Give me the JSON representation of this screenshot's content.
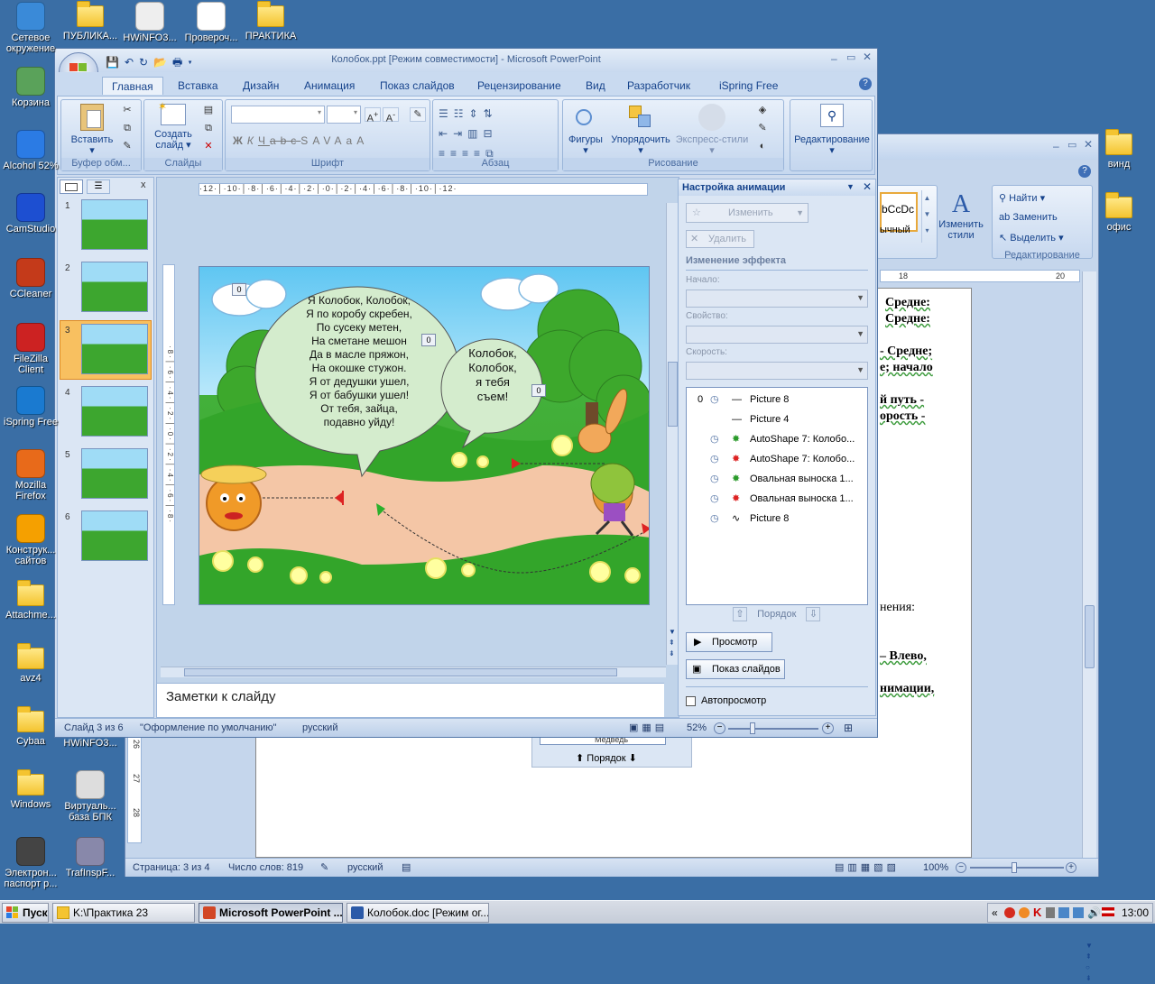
{
  "desktop": {
    "icons_left": [
      {
        "label": "Сетевое окружение",
        "icon": "network-icon"
      },
      {
        "label": "Корзина",
        "icon": "recycle-bin-icon"
      },
      {
        "label": "Alcohol 52%",
        "icon": "alcohol-icon"
      },
      {
        "label": "CamStudio",
        "icon": "camstudio-icon"
      },
      {
        "label": "CCleaner",
        "icon": "ccleaner-icon"
      },
      {
        "label": "FileZilla Client",
        "icon": "filezilla-icon"
      },
      {
        "label": "iSpring Free",
        "icon": "ispring-icon"
      },
      {
        "label": "Mozilla Firefox",
        "icon": "firefox-icon"
      },
      {
        "label": "Конструк... сайтов",
        "icon": "constructor-icon"
      },
      {
        "label": "Attachme...",
        "icon": "folder-icon"
      },
      {
        "label": "avz4",
        "icon": "folder-icon"
      },
      {
        "label": "Cybaa",
        "icon": "folder-icon"
      },
      {
        "label": "Windows",
        "icon": "folder-icon"
      },
      {
        "label": "Электрон... паспорт р...",
        "icon": "passport-icon"
      }
    ],
    "icons_top": [
      {
        "label": "ПУБЛИКА...",
        "icon": "folder-icon"
      },
      {
        "label": "HWiNFO3...",
        "icon": "hwinfo-icon"
      },
      {
        "label": "Провероч...",
        "icon": "word-doc-icon"
      },
      {
        "label": "ПРАКТИКА",
        "icon": "folder-icon"
      }
    ],
    "icons_col2": [
      {
        "label": "HWiNFO3...",
        "icon": "hwinfo-icon"
      },
      {
        "label": "Виртуаль... база БПК",
        "icon": "database-icon"
      },
      {
        "label": "TrafInspF...",
        "icon": "trafinsp-icon"
      }
    ],
    "icons_right": [
      {
        "label": "винд",
        "icon": "folder-icon"
      },
      {
        "label": "офис",
        "icon": "folder-icon"
      }
    ]
  },
  "taskbar": {
    "start": "Пуск",
    "buttons": [
      "K:\\Практика 23",
      "Microsoft PowerPoint ...",
      "Колобок.doc [Режим ог..."
    ],
    "clock": "13:00"
  },
  "word": {
    "find": "Найти",
    "replace": "Заменить",
    "select": "Выделить",
    "change_styles": "Изменить стили",
    "style_preview": "bCcDc",
    "style_name": "ычный",
    "edit_group": "Редактирование",
    "ruler_marks": [
      "18",
      "20"
    ],
    "doc_lines": [
      "Средне:",
      "Средне:",
      "- Средне;",
      "е; начало",
      "й путь -",
      "орость -",
      "нения:",
      "– Влево,",
      "нимации,"
    ],
    "mini_order": "Порядок",
    "mini_field": "Медведь",
    "status": {
      "page": "Страница: 3 из 4",
      "words": "Число слов: 819",
      "lang": "русский",
      "zoom": "100%"
    },
    "vruler": [
      "26",
      "27",
      "28"
    ]
  },
  "ppt": {
    "title": "Колобок.ppt [Режим совместимости] - Microsoft PowerPoint",
    "tabs": [
      "Главная",
      "Вставка",
      "Дизайн",
      "Анимация",
      "Показ слайдов",
      "Рецензирование",
      "Вид",
      "Разработчик",
      "iSpring Free"
    ],
    "groups": {
      "clipboard": "Буфер обм...",
      "slides": "Слайды",
      "font": "Шрифт",
      "paragraph": "Абзац",
      "drawing": "Рисование",
      "editing": "Редактирование"
    },
    "buttons": {
      "paste": "Вставить",
      "new_slide": "Создать слайд",
      "shapes": "Фигуры",
      "arrange": "Упорядочить",
      "quick_styles": "Экспресс-стили",
      "editing": "Редактирование"
    },
    "panel_tabs_close": "x",
    "slide_numbers": [
      "1",
      "2",
      "3",
      "4",
      "5",
      "6"
    ],
    "slide": {
      "bubble1": [
        "Я Колобок, Колобок,",
        "Я по коробу скребен,",
        "По сусеку метен,",
        "На сметане мешон",
        "Да в масле пряжон,",
        "На окошке стужон.",
        "Я от дедушки ушел,",
        "Я от бабушки ушел!",
        "От тебя, зайца,",
        "подавно уйду!"
      ],
      "bubble2": [
        "Колобок,",
        "Колобок,",
        "я тебя",
        "съем!"
      ],
      "tag0a": "0",
      "tag0b": "0",
      "tag0c": "0"
    },
    "notes": "Заметки к слайду",
    "status": {
      "slide": "Слайд 3 из 6",
      "theme": "\"Оформление по умолчанию\"",
      "lang": "русский",
      "zoom": "52%"
    },
    "anim": {
      "title": "Настройка анимации",
      "change": "Изменить",
      "delete": "Удалить",
      "effect_header": "Изменение эффекта",
      "start": "Начало:",
      "property": "Свойство:",
      "speed": "Скорость:",
      "items": [
        {
          "num": "0",
          "name": "Picture 8"
        },
        {
          "num": "",
          "name": "Picture 4"
        },
        {
          "num": "",
          "name": "AutoShape 7: Колобо..."
        },
        {
          "num": "",
          "name": "AutoShape 7: Колобо..."
        },
        {
          "num": "",
          "name": "Овальная выноска 1..."
        },
        {
          "num": "",
          "name": "Овальная выноска 1..."
        },
        {
          "num": "",
          "name": "Picture 8"
        }
      ],
      "order": "Порядок",
      "preview": "Просмотр",
      "slideshow": "Показ слайдов",
      "autopreview": "Автопросмотр"
    }
  }
}
